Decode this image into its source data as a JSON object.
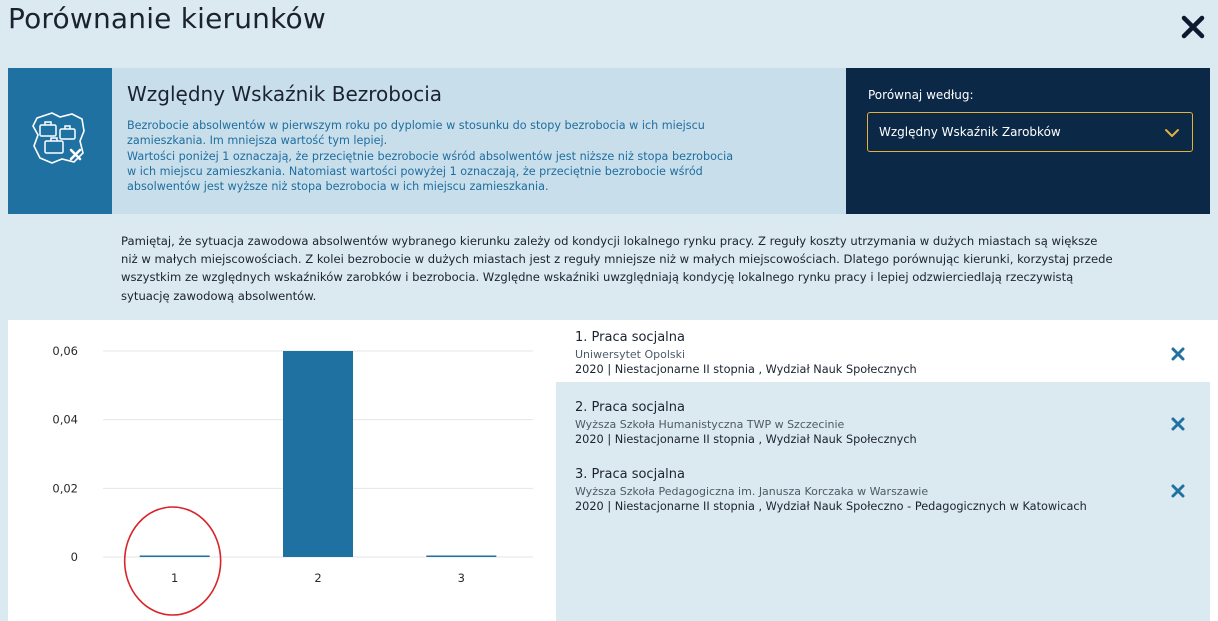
{
  "modal": {
    "title": "Porównanie kierunków",
    "close_icon": "close-icon"
  },
  "indicator": {
    "icon": "map-with-briefcases-icon",
    "title": "Względny Wskaźnik Bezrobocia",
    "description_lines": [
      "Bezrobocie absolwentów w pierwszym roku po dyplomie w stosunku do stopy bezrobocia w ich miejscu",
      "zamieszkania. Im mniejsza wartość tym lepiej.",
      "Wartości poniżej 1 oznaczają, że przeciętnie bezrobocie wśród absolwentów jest niższe niż stopa bezrobocia",
      "w ich miejscu zamieszkania. Natomiast wartości powyżej 1 oznaczają, że przeciętnie bezrobocie wśród",
      "absolwentów jest wyższe niż stopa bezrobocia w ich miejscu zamieszkania."
    ]
  },
  "compare": {
    "label": "Porównaj według:",
    "selected": "Względny Wskaźnik Zarobków",
    "chevron_icon": "chevron-down-icon"
  },
  "note_lines": [
    "Pamiętaj, że sytuacja zawodowa absolwentów wybranego kierunku zależy od kondycji lokalnego rynku pracy. Z reguły koszty utrzymania w dużych miastach są większe",
    "niż w małych miejscowościach. Z kolei bezrobocie w dużych miastach jest z reguły mniejsze niż w małych miejscowościach. Dlatego porównując kierunki, korzystaj przede",
    "wszystkim ze względnych wskaźników zarobków i bezrobocia. Względne wskaźniki uwzględniają kondycję lokalnego rynku pracy i lepiej odzwierciedlają rzeczywistą",
    "sytuację zawodową absolwentów."
  ],
  "chart_data": {
    "type": "bar",
    "categories": [
      "1",
      "2",
      "3"
    ],
    "values": [
      0,
      0.06,
      0
    ],
    "ylim": [
      0,
      0.06
    ],
    "yticks": [
      0,
      0.02,
      0.04,
      0.06
    ],
    "ytick_labels": [
      "0",
      "0,02",
      "0,04",
      "0,06"
    ],
    "grid": true,
    "bar_color": "#1f71a2",
    "highlight_marker": {
      "category": "1",
      "shape": "ellipse",
      "color": "#d9232a"
    }
  },
  "programs": [
    {
      "title": "1. Praca socjalna",
      "university": "Uniwersytet Opolski",
      "details": "2020 | Niestacjonarne II stopnia , Wydział Nauk Społecznych",
      "remove_icon": "remove-icon"
    },
    {
      "title": "2. Praca socjalna",
      "university": "Wyższa Szkoła Humanistyczna TWP w Szczecinie",
      "details": "2020 | Niestacjonarne II stopnia , Wydział Nauk Społecznych",
      "remove_icon": "remove-icon"
    },
    {
      "title": "3. Praca socjalna",
      "university": "Wyższa Szkoła Pedagogiczna im. Janusza Korczaka w Warszawie",
      "details": "2020 | Niestacjonarne II stopnia , Wydział Nauk Społeczno - Pedagogicznych w Katowicach",
      "remove_icon": "remove-icon"
    }
  ],
  "colors": {
    "accent": "#1f71a2",
    "navy": "#0b2847",
    "panel_light": "#dbe9f1",
    "select_border": "#e3b23c",
    "marker_red": "#d9232a"
  }
}
